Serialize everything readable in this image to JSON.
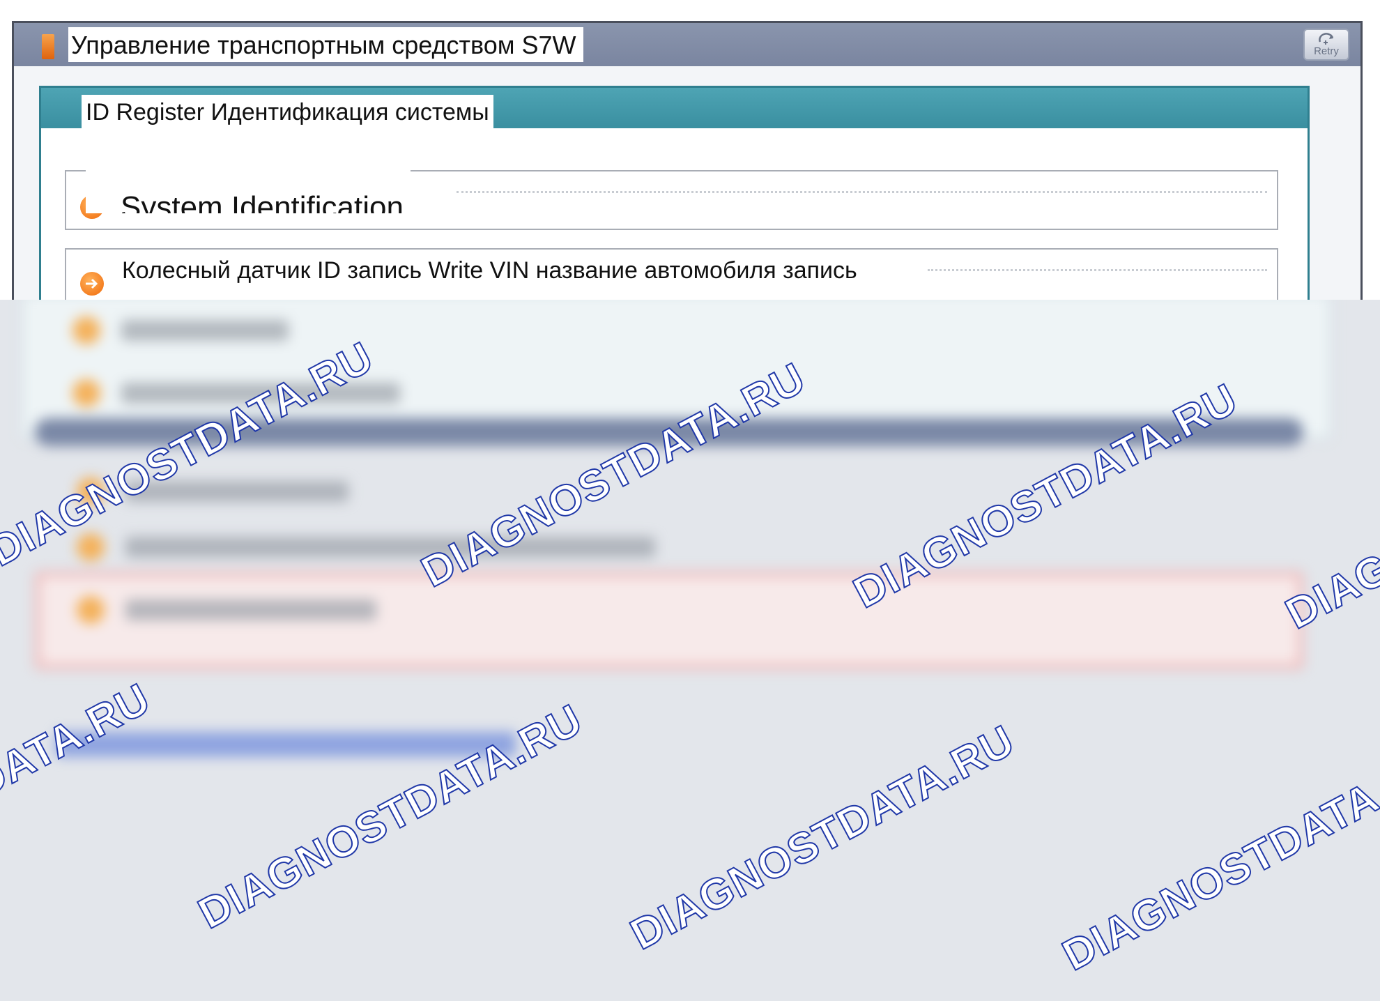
{
  "window": {
    "title": "Управление транспортным средством S7W",
    "retry_label": "Retry"
  },
  "panel": {
    "title": "ID Register Идентификация системы",
    "items": [
      {
        "label": "System Identification"
      },
      {
        "label": "Колесный датчик ID запись Write VIN название автомобиля запись"
      }
    ]
  },
  "watermark": "DIAGNOSTDATA.RU",
  "colors": {
    "titlebar": "#7a85a0",
    "panel_header": "#3a8fa0",
    "arrow_icon": "#f06a0a",
    "watermark_stroke": "#2038a8"
  }
}
